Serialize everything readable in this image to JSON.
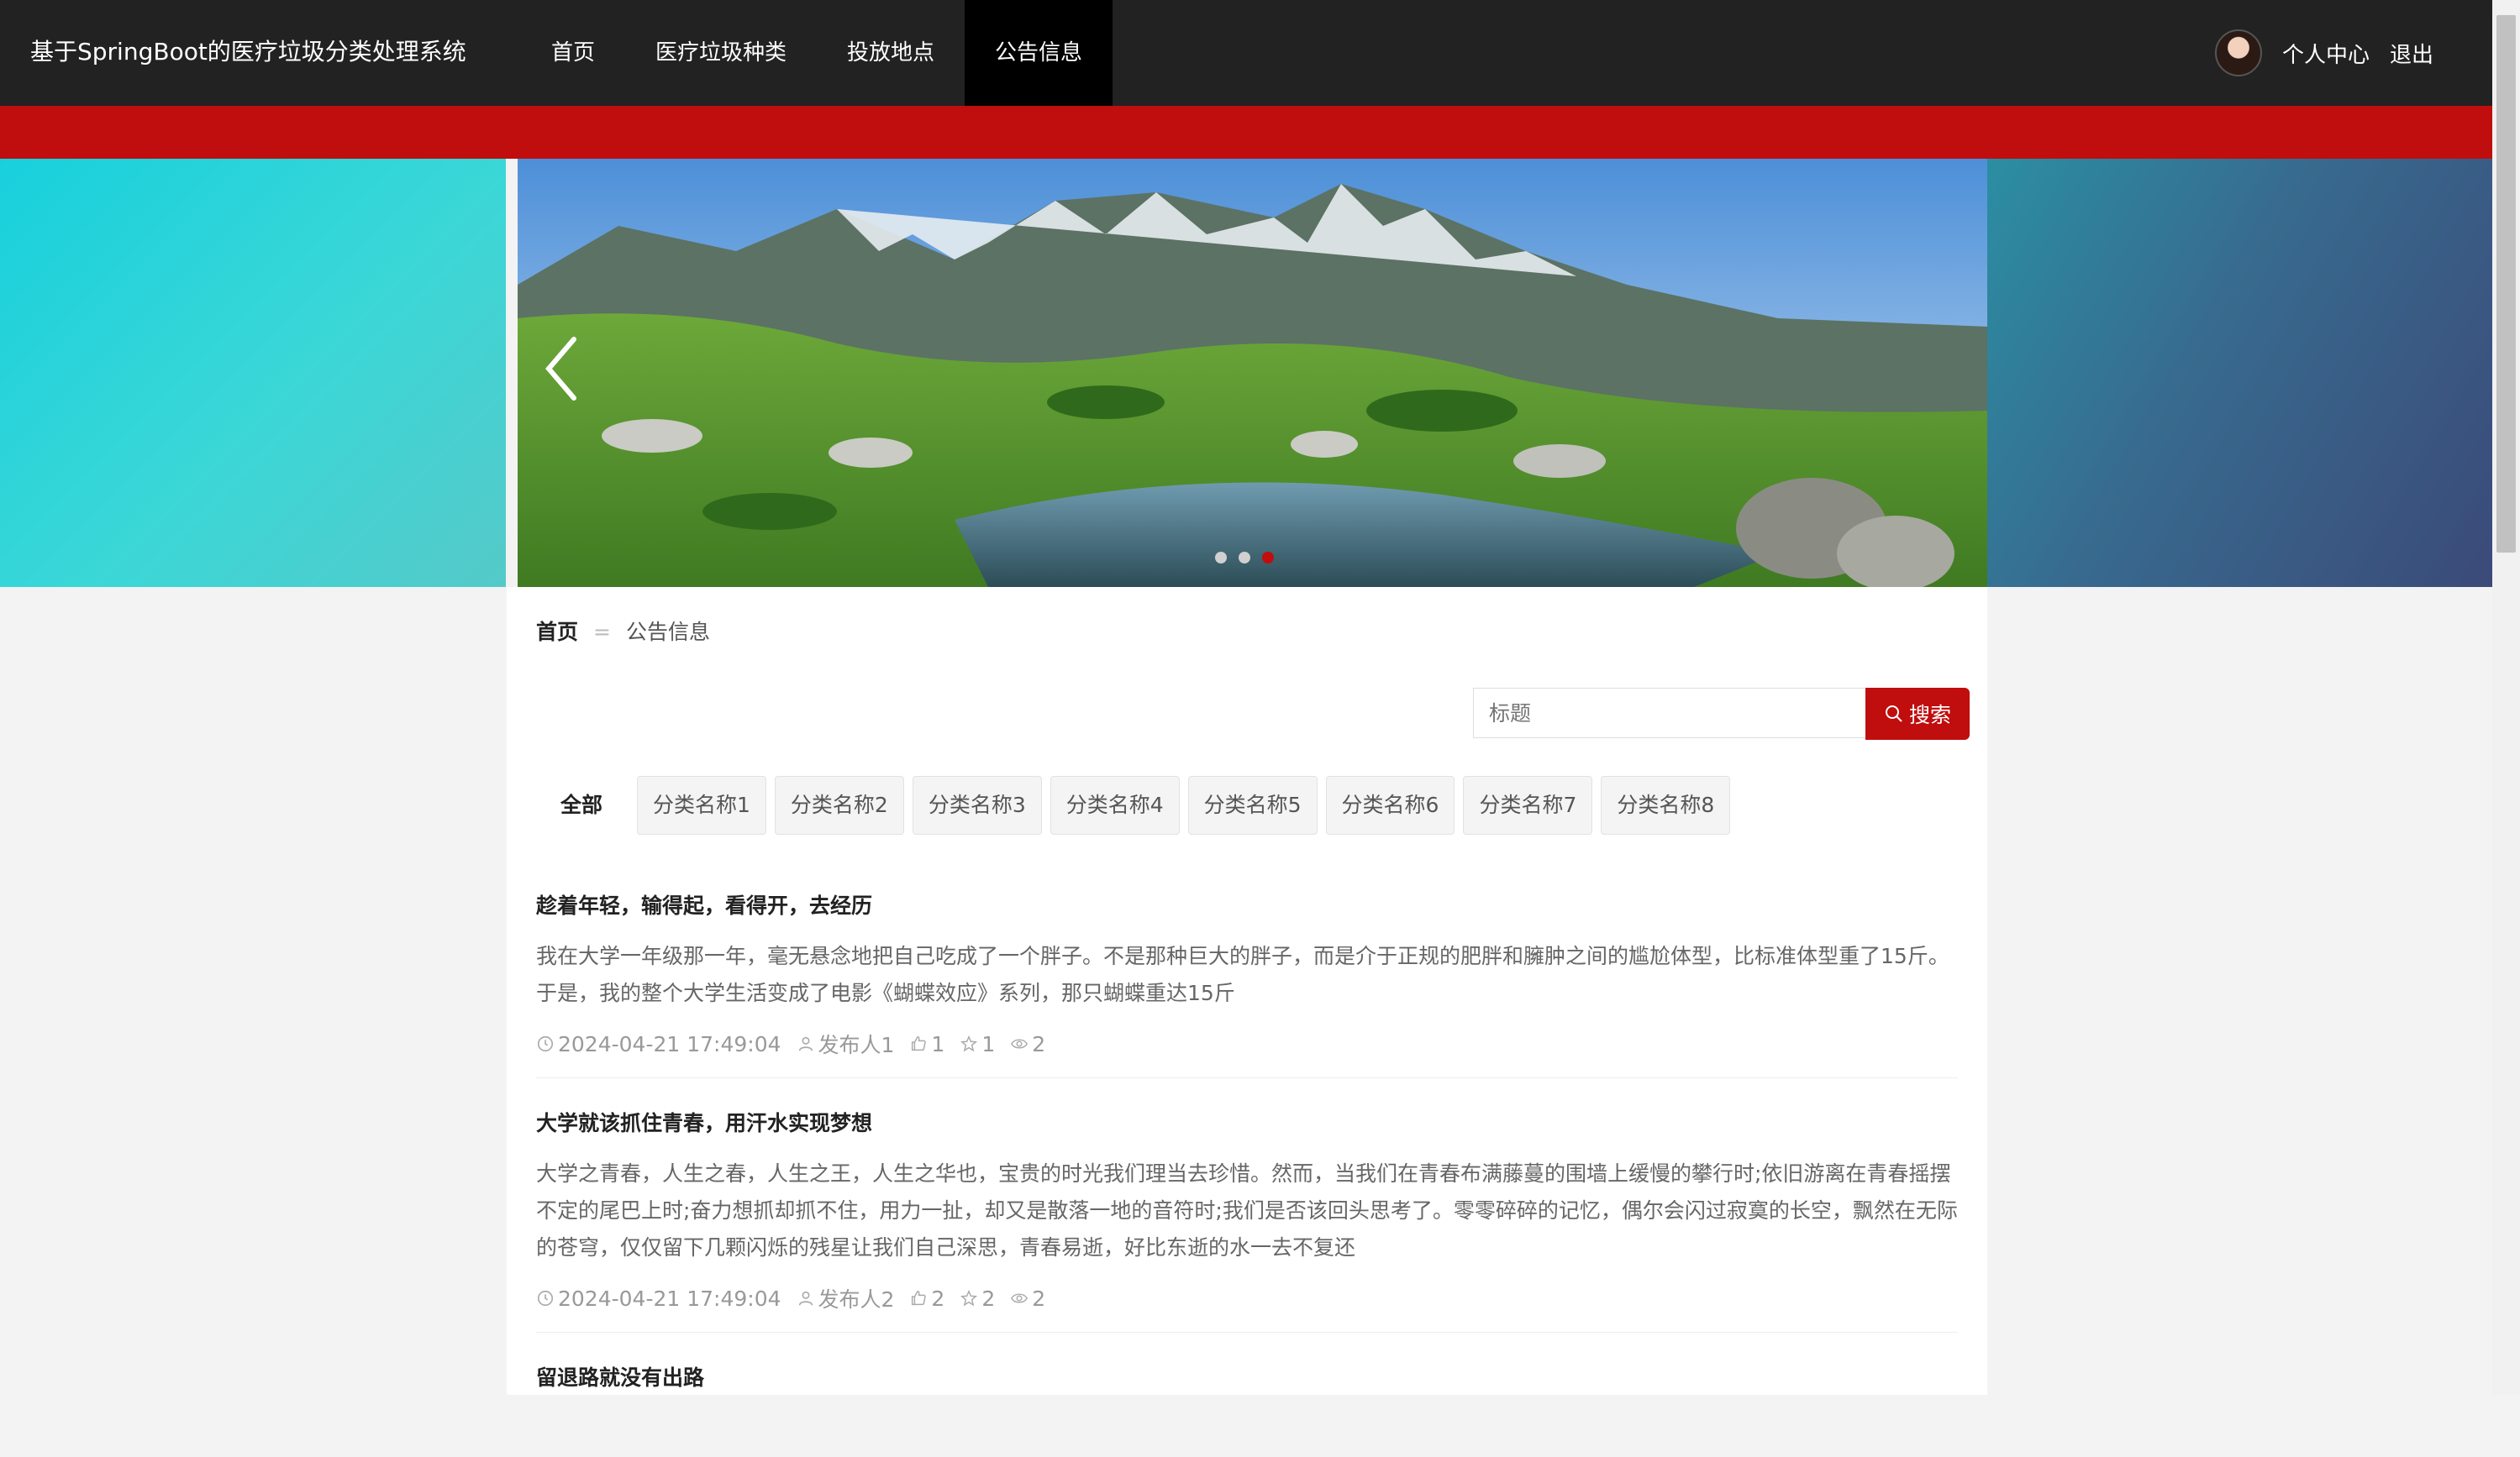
{
  "app": {
    "title": "基于SpringBoot的医疗垃圾分类处理系统"
  },
  "nav": {
    "items": [
      {
        "label": "首页"
      },
      {
        "label": "医疗垃圾种类"
      },
      {
        "label": "投放地点"
      },
      {
        "label": "公告信息",
        "active": true
      }
    ]
  },
  "user": {
    "center_label": "个人中心",
    "logout_label": "退出"
  },
  "banner": {
    "dots": 3,
    "active_dot": 3
  },
  "breadcrumb": {
    "home": "首页",
    "separator": "=",
    "current": "公告信息"
  },
  "search": {
    "placeholder": "标题",
    "button_label": "搜索"
  },
  "categories": {
    "all_label": "全部",
    "items": [
      "分类名称1",
      "分类名称2",
      "分类名称3",
      "分类名称4",
      "分类名称5",
      "分类名称6",
      "分类名称7",
      "分类名称8"
    ]
  },
  "posts": [
    {
      "title": "趁着年轻，输得起，看得开，去经历",
      "body": "我在大学一年级那一年，毫无悬念地把自己吃成了一个胖子。不是那种巨大的胖子，而是介于正规的肥胖和臃肿之间的尴尬体型，比标准体型重了15斤。于是，我的整个大学生活变成了电影《蝴蝶效应》系列，那只蝴蝶重达15斤",
      "date": "2024-04-21 17:49:04",
      "author": "发布人1",
      "likes": "1",
      "favorites": "1",
      "views": "2"
    },
    {
      "title": "大学就该抓住青春，用汗水实现梦想",
      "body": "大学之青春，人生之春，人生之王，人生之华也，宝贵的时光我们理当去珍惜。然而，当我们在青春布满藤蔓的围墙上缓慢的攀行时;依旧游离在青春摇摆不定的尾巴上时;奋力想抓却抓不住，用力一扯，却又是散落一地的音符时;我们是否该回头思考了。零零碎碎的记忆，偶尔会闪过寂寞的长空，飘然在无际的苍穹，仅仅留下几颗闪烁的残星让我们自己深思，青春易逝，好比东逝的水一去不复还",
      "date": "2024-04-21 17:49:04",
      "author": "发布人2",
      "likes": "2",
      "favorites": "2",
      "views": "2"
    },
    {
      "title": "留退路就没有出路"
    }
  ],
  "colors": {
    "accent": "#c00d0d",
    "topbar": "#222222",
    "active_nav": "#000000"
  },
  "icons": {
    "prev": "chevron-left-icon",
    "search": "search-icon",
    "clock": "clock-icon",
    "user": "user-icon",
    "like": "thumbs-up-icon",
    "favorite": "star-icon",
    "view": "eye-icon"
  }
}
